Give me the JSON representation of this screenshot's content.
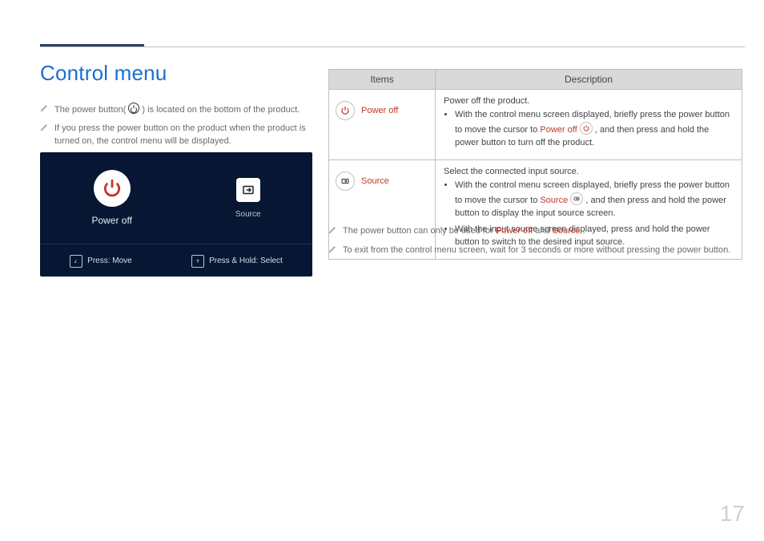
{
  "heading": "Control menu",
  "left_notes": {
    "n1_a": "The power button(",
    "n1_b": ") is located on the bottom of the product.",
    "n2": "If you press the power button on the product when the product is turned on, the control menu will be displayed."
  },
  "panel": {
    "power_label": "Power off",
    "source_label": "Source",
    "press_move": "Press: Move",
    "press_hold": "Press & Hold: Select"
  },
  "table": {
    "head_items": "Items",
    "head_desc": "Description",
    "row_power": {
      "item_label": "Power off",
      "lead": "Power off the product.",
      "b1_a": "With the control menu screen displayed, briefly press the power button to move the cursor to ",
      "b1_red": "Power off",
      "b1_b": ", and then press and hold the power button to turn off the product."
    },
    "row_source": {
      "item_label": "Source",
      "lead": "Select the connected input source.",
      "b1_a": "With the control menu screen displayed, briefly press the power button to move the cursor to ",
      "b1_red": "Source",
      "b1_b": ", and then press and hold the power button to display the input source screen.",
      "b2": "With the input source screen displayed, press and hold the power button to switch to the desired input source."
    }
  },
  "below": {
    "n1_a": "The power button can only be used for ",
    "n1_p": "Power off",
    "n1_and": " and ",
    "n1_s": "Source",
    "n1_dot": ".",
    "n2": "To exit from the control menu screen, wait for 3 seconds or more without pressing the power button."
  },
  "page_number": "17"
}
